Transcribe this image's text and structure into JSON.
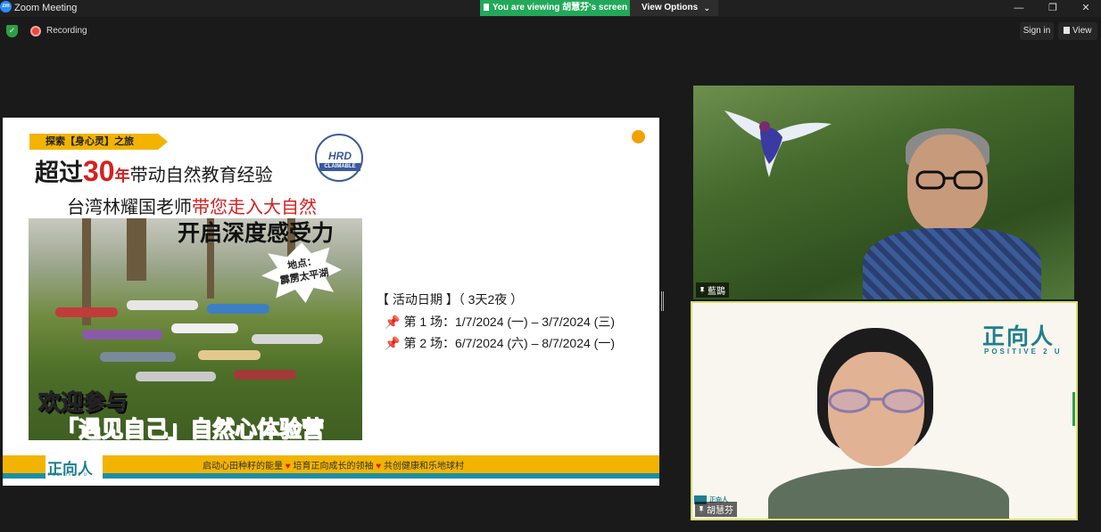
{
  "window": {
    "app_logo": "zm",
    "title": "Zoom Meeting",
    "share_banner": "You are viewing 胡慧芬's screen",
    "view_options": "View Options",
    "minimize": "—",
    "restore": "❐",
    "close": "✕"
  },
  "toolbar": {
    "recording": "Recording",
    "sign_in": "Sign in",
    "view": "View"
  },
  "slide": {
    "tag": "探索【身心灵】之旅",
    "headline1_pre": "超过",
    "headline1_num": "30",
    "headline1_year": "年",
    "headline1_rest": "带动自然教育经验",
    "headline2_pre": "台湾林耀国老师",
    "headline2_red": "带您走入大自然",
    "headline3": "开启深度感受力",
    "badge_hrd": "HRD",
    "badge_claim": "CLAIMABLE",
    "location": "地点：\n霹雳太平湖",
    "welcome1": "欢迎参与",
    "welcome2": "「遇见自己」自然心体验营",
    "event_title": "【 活动日期 】（ 3天2夜 ）",
    "sessions": [
      "第 1 场：1/7/2024 (一) – 3/7/2024 (三)",
      "第 2 场：6/7/2024 (六) – 8/7/2024 (一)"
    ],
    "footer_logo": "正向人",
    "footer_logo_sub": "POSITIVE 2 U",
    "motto_1": "启动心田种籽的能量",
    "motto_2": "培育正向成长的领袖",
    "motto_3": "共创健康和乐地球村",
    "heart": "♥",
    "pin": "📌"
  },
  "participants": [
    {
      "name": "藍鵲"
    },
    {
      "name": "胡慧芬",
      "logo": "正向人",
      "logo_sub": "POSITIVE 2 U",
      "mini_logo": "正向人"
    }
  ],
  "colors": {
    "share_banner": "#23a85a",
    "accent_yellow": "#f2b400",
    "brand_teal": "#1e7e8f",
    "highlight_red": "#d42020",
    "active_speaker_border": "#d7e06a"
  }
}
